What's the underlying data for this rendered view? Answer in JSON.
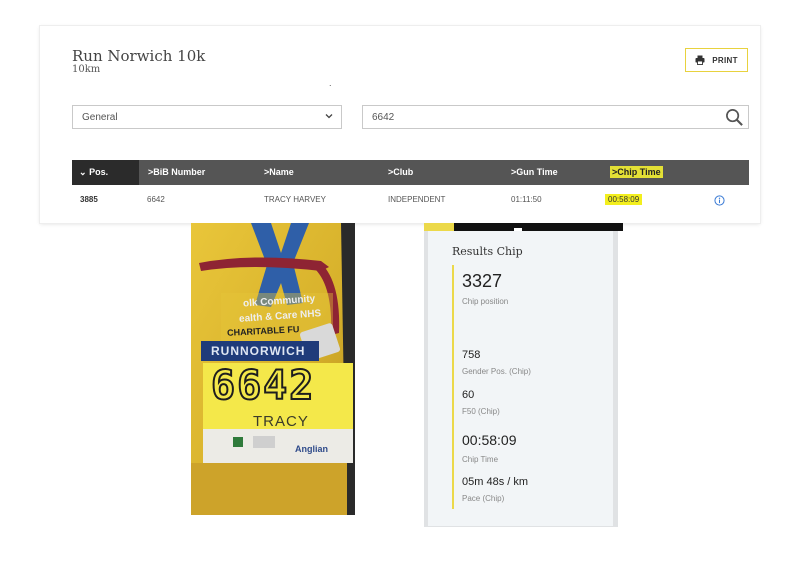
{
  "race": {
    "title": "Run Norwich 10k",
    "distance": "10km",
    "dot": "."
  },
  "print": {
    "label": "PRINT",
    "icon": "printer-icon"
  },
  "filters": {
    "category_selected": "General",
    "search_value": "6642",
    "chevron_icon": "chevron-down-icon",
    "search_icon": "search-icon"
  },
  "table": {
    "headers": {
      "pos": "Pos.",
      "bib": ">BiB Number",
      "name": ">Name",
      "club": ">Club",
      "gun": ">Gun Time",
      "chip": ">Chip Time"
    },
    "row": {
      "pos": "3885",
      "bib": "6642",
      "name": "TRACY HARVEY",
      "club": "INDEPENDENT",
      "gun": "01:11:50",
      "chip": "00:58:09"
    },
    "highlight_color": "#f3ef1e",
    "info_icon": "info-icon"
  },
  "photo": {
    "bib_number": "6642",
    "bib_name": "TRACY",
    "banner": "RUNNORWICH",
    "lanyard_lines": [
      "olk Community",
      "ealth & Care NHS",
      "CHARITABLE FU"
    ],
    "sponsor": "Anglian"
  },
  "results_chip": {
    "title": "Results Chip",
    "accent_color": "#ecd94a",
    "stats": [
      {
        "value": "3327",
        "label": "Chip position"
      },
      {
        "value": "758",
        "label": "Gender Pos. (Chip)"
      },
      {
        "value": "60",
        "label": "F50 (Chip)"
      },
      {
        "value": "00:58:09",
        "label": "Chip Time"
      },
      {
        "value": "05m 48s / km",
        "label": "Pace (Chip)"
      }
    ]
  }
}
